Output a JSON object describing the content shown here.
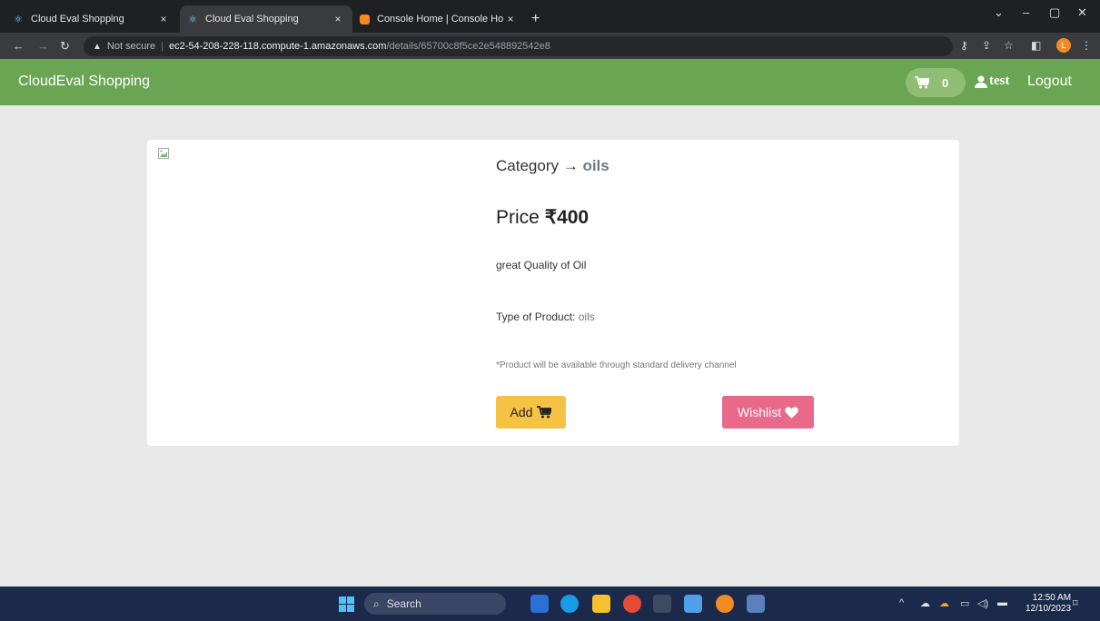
{
  "browser": {
    "tabs": [
      {
        "title": "Cloud Eval Shopping",
        "close": "×"
      },
      {
        "title": "Cloud Eval Shopping",
        "close": "×"
      },
      {
        "title": "Console Home | Console Home",
        "close": "×"
      }
    ],
    "new_tab": "+",
    "address": {
      "security": "Not secure",
      "host": "ec2-54-208-228-118.compute-1.amazonaws.com",
      "path": "/details/65700c8f5ce2e548892542e8"
    },
    "profile_initial": "L"
  },
  "navbar": {
    "brand": "CloudEval Shopping",
    "cart_count": "0",
    "user": "test",
    "logout": "Logout",
    "color": "#6aa553"
  },
  "product": {
    "category_label": "Category →",
    "category": "oils",
    "price_label": "Price",
    "price": "₹400",
    "description": "great Quality of Oil",
    "type_label": "Type of Product:",
    "type_value": "oils",
    "delivery_note": "*Product will be available through standard delivery channel",
    "add_label": "Add",
    "wishlist_label": "Wishlist",
    "add_color": "#f6c244",
    "wishlist_color": "#e8698a"
  },
  "taskbar": {
    "search_label": "Search",
    "time": "12:50 AM",
    "date": "12/10/2023"
  }
}
